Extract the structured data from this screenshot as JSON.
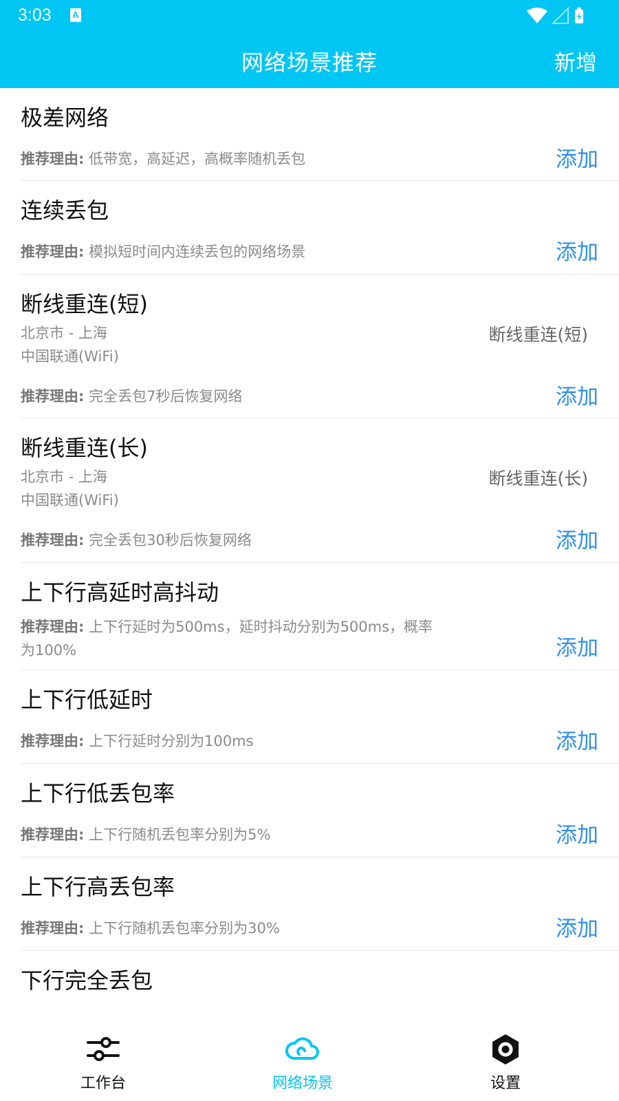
{
  "status": {
    "time": "3:03",
    "a_icon": "A"
  },
  "header": {
    "title": "网络场景推荐",
    "add_new": "新增"
  },
  "reason_label": "推荐理由:",
  "items": [
    {
      "title": "极差网络",
      "reason": "低带宽，高延迟，高概率随机丢包",
      "add": "添加"
    },
    {
      "title": "连续丢包",
      "reason": "模拟短时间内连续丢包的网络场景",
      "add": "添加"
    },
    {
      "title": "断线重连(短)",
      "loc1": "北京市 - 上海",
      "loc2": "中国联通(WiFi)",
      "tag": "断线重连(短)",
      "reason": "完全丢包7秒后恢复网络",
      "add": "添加"
    },
    {
      "title": "断线重连(长)",
      "loc1": "北京市 - 上海",
      "loc2": "中国联通(WiFi)",
      "tag": "断线重连(长)",
      "reason": "完全丢包30秒后恢复网络",
      "add": "添加"
    },
    {
      "title": "上下行高延时高抖动",
      "reason_line1": "上下行延时为500ms，延时抖动分别为500ms，概率",
      "reason_line2": "为100%",
      "add": "添加"
    },
    {
      "title": "上下行低延时",
      "reason": "上下行延时分别为100ms",
      "add": "添加"
    },
    {
      "title": "上下行低丢包率",
      "reason": "上下行随机丢包率分别为5%",
      "add": "添加"
    },
    {
      "title": "上下行高丢包率",
      "reason": "上下行随机丢包率分别为30%",
      "add": "添加"
    },
    {
      "title": "下行完全丢包"
    }
  ],
  "tabs": [
    {
      "label": "工作台",
      "icon": "sliders-icon",
      "active": false
    },
    {
      "label": "网络场景",
      "icon": "cloud-icon",
      "active": true
    },
    {
      "label": "设置",
      "icon": "hexagon-gear-icon",
      "active": false
    }
  ],
  "colors": {
    "accent": "#00c6f4",
    "link": "#2f8ff0",
    "text": "#111111",
    "muted": "#8a8a8a"
  }
}
